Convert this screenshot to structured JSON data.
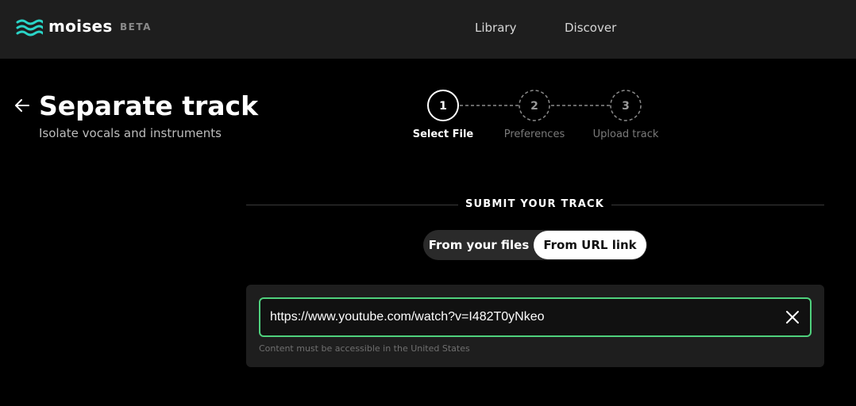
{
  "header": {
    "logo_text": "moises",
    "logo_badge": "BETA",
    "nav": [
      {
        "label": "Library"
      },
      {
        "label": "Discover"
      }
    ]
  },
  "page": {
    "title": "Separate track",
    "subtitle": "Isolate vocals and instruments"
  },
  "stepper": {
    "steps": [
      {
        "number": "1",
        "label": "Select File",
        "active": true
      },
      {
        "number": "2",
        "label": "Preferences",
        "active": false
      },
      {
        "number": "3",
        "label": "Upload track",
        "active": false
      }
    ]
  },
  "submit": {
    "section_title": "SUBMIT YOUR TRACK",
    "toggle": {
      "from_files_label": "From your files",
      "from_url_label": "From URL link",
      "selected": "From URL link"
    },
    "url_input": {
      "value": "https://www.youtube.com/watch?v=I482T0yNkeo",
      "placeholder": ""
    },
    "hint": "Content must be accessible in the United States"
  },
  "colors": {
    "accent": "#4fd17d",
    "logo_accent": "#2ad4c7",
    "header_bg": "#1e1e1e",
    "page_bg": "#000000"
  }
}
